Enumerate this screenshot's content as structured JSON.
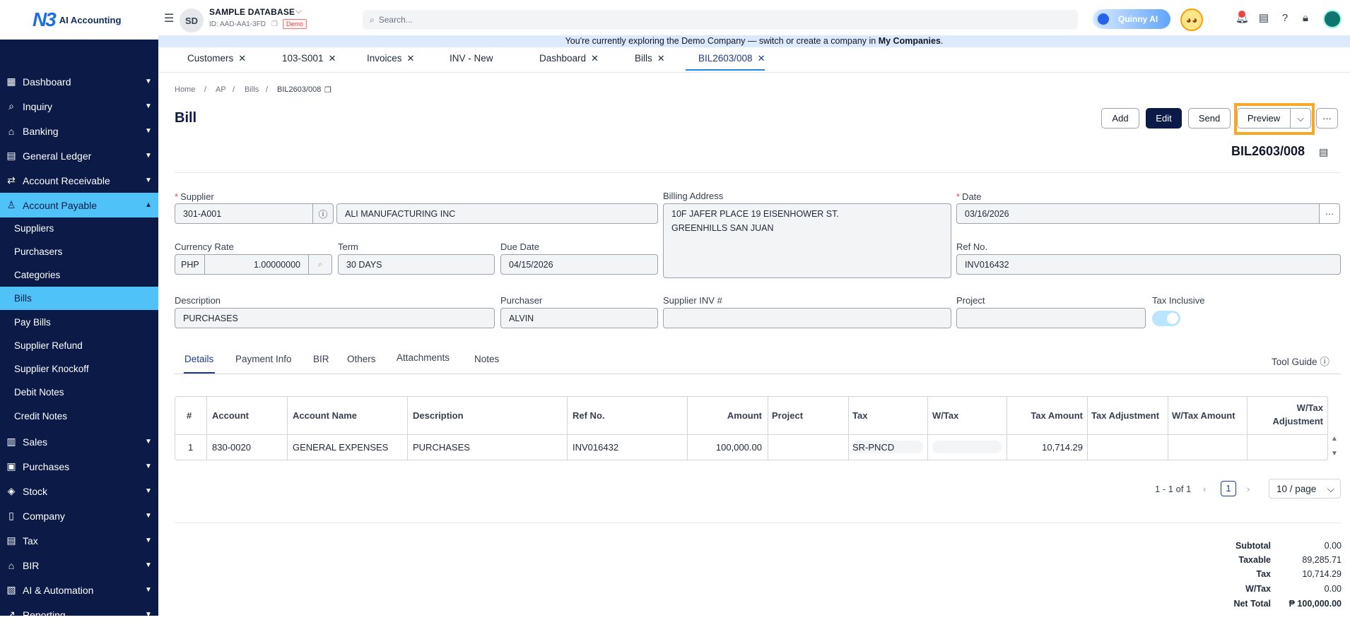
{
  "header": {
    "logo_mark": "N3",
    "logo_text": "AI Accounting",
    "avatar_initials": "SD",
    "db_name": "SAMPLE DATABASE",
    "db_id": "ID: AAD-AA1-3FD",
    "demo_badge": "Demo",
    "search_placeholder": "Search...",
    "ai_button": "Quinny AI"
  },
  "banner": {
    "text": "You're currently exploring the Demo Company — switch or create a company in ",
    "link": "My Companies",
    "end": "."
  },
  "sidebar": {
    "items": [
      {
        "label": "Dashboard",
        "icon": "dashboard-icon"
      },
      {
        "label": "Inquiry",
        "icon": "inquiry-icon"
      },
      {
        "label": "Banking",
        "icon": "bank-icon"
      },
      {
        "label": "General Ledger",
        "icon": "ledger-icon"
      },
      {
        "label": "Account Receivable",
        "icon": "receivable-icon"
      },
      {
        "label": "Account Payable",
        "icon": "payable-icon"
      },
      {
        "label": "Sales",
        "icon": "sales-icon"
      },
      {
        "label": "Purchases",
        "icon": "purchases-icon"
      },
      {
        "label": "Stock",
        "icon": "stock-icon"
      },
      {
        "label": "Company",
        "icon": "company-icon"
      },
      {
        "label": "Tax",
        "icon": "tax-icon"
      },
      {
        "label": "BIR",
        "icon": "bir-icon"
      },
      {
        "label": "AI & Automation",
        "icon": "ai-icon"
      },
      {
        "label": "Reporting",
        "icon": "reporting-icon"
      }
    ],
    "subitems": [
      "Suppliers",
      "Purchasers",
      "Categories",
      "Bills",
      "Pay Bills",
      "Supplier Refund",
      "Supplier Knockoff",
      "Debit Notes",
      "Credit Notes"
    ]
  },
  "page_tabs": [
    "Customers",
    "103-S001",
    "Invoices",
    "INV - New",
    "Dashboard",
    "Bills",
    "BIL2603/008"
  ],
  "breadcrumb": [
    "Home",
    "AP",
    "Bills",
    "BIL2603/008"
  ],
  "page": {
    "title": "Bill",
    "doc_no": "BIL2603/008",
    "buttons": {
      "add": "Add",
      "edit": "Edit",
      "send": "Send",
      "preview": "Preview",
      "more": "···"
    }
  },
  "form": {
    "supplier_label": "Supplier",
    "supplier_code": "301-A001",
    "supplier_name": "ALI MANUFACTURING INC",
    "billing_label": "Billing Address",
    "billing_line1": "10F JAFER PLACE 19 EISENHOWER ST.",
    "billing_line2": "GREENHILLS SAN JUAN",
    "date_label": "Date",
    "date": "03/16/2026",
    "currency_label": "Currency Rate",
    "currency": "PHP",
    "rate": "1.00000000",
    "term_label": "Term",
    "term": "30 DAYS",
    "due_label": "Due Date",
    "due": "04/15/2026",
    "ref_label": "Ref No.",
    "ref": "INV016432",
    "desc_label": "Description",
    "desc": "PURCHASES",
    "purchaser_label": "Purchaser",
    "purchaser": "ALVIN",
    "supinv_label": "Supplier INV #",
    "supinv": "",
    "project_label": "Project",
    "project": "",
    "taxinc_label": "Tax Inclusive",
    "tax_inclusive": true
  },
  "detail_tabs": [
    "Details",
    "Payment Info",
    "BIR",
    "Others",
    "Attachments",
    "Notes"
  ],
  "tool_guide": "Tool Guide",
  "table": {
    "columns": [
      "#",
      "Account",
      "Account Name",
      "Description",
      "Ref No.",
      "Amount",
      "Project",
      "Tax",
      "W/Tax",
      "Tax Amount",
      "Tax Adjustment",
      "W/Tax Amount",
      "W/Tax",
      "Adjustment"
    ],
    "row": {
      "no": "1",
      "account": "830-0020",
      "account_name": "GENERAL EXPENSES",
      "description": "PURCHASES",
      "ref": "INV016432",
      "amount": "100,000.00",
      "project": "",
      "tax": "SR-PNCD",
      "wtax": "",
      "tax_amount": "10,714.29",
      "tax_adj": "",
      "wtax_amount": "",
      "wtax_adj": ""
    }
  },
  "pagination": {
    "range": "1 - 1 of 1",
    "page": "1",
    "per_page": "10 / page"
  },
  "totals": {
    "subtotal_label": "Subtotal",
    "subtotal": "0.00",
    "taxable_label": "Taxable",
    "taxable": "89,285.71",
    "tax_label": "Tax",
    "tax": "10,714.29",
    "wtax_label": "W/Tax",
    "wtax": "0.00",
    "net_label": "Net Total",
    "net": "₱ 100,000.00"
  },
  "colors": {
    "sidebar": "#0b1a47",
    "accent": "#4fc3f7",
    "highlight": "#f9a825",
    "primary": "#0b1a47"
  }
}
